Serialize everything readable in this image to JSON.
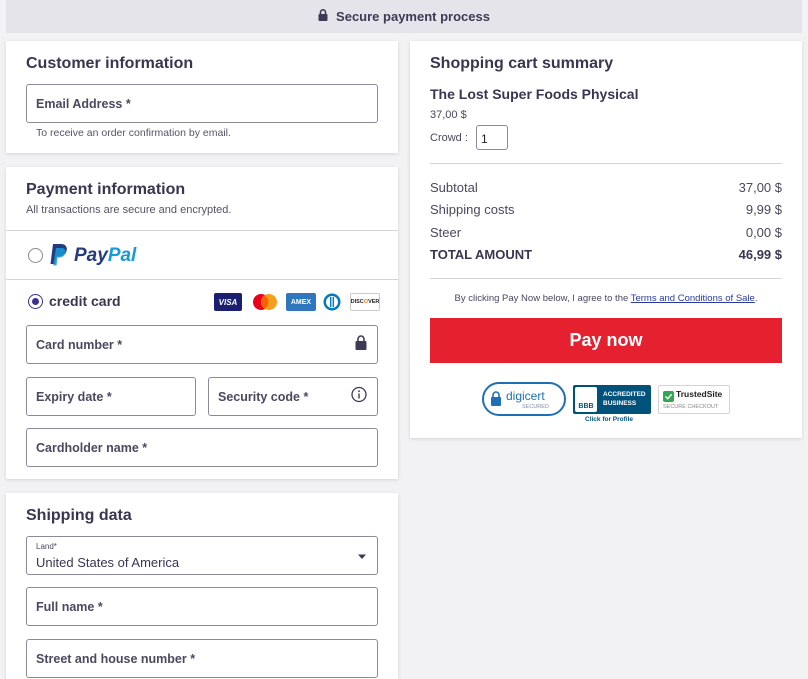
{
  "topbar": {
    "text": "Secure payment process",
    "icon": "lock-icon"
  },
  "customer": {
    "title": "Customer information",
    "email_label": "Email Address *",
    "email_hint": "To receive an order confirmation by email."
  },
  "payment": {
    "title": "Payment information",
    "subtitle": "All transactions are secure and encrypted.",
    "paypal_label": "PayPal",
    "paypal_label_a": "Pay",
    "paypal_label_b": "Pal",
    "credit_card_label": "credit card",
    "card_logos": [
      "VISA",
      "Mastercard",
      "AMEX",
      "Diners",
      "DISCOVER"
    ],
    "card_number_label": "Card number *",
    "expiry_label": "Expiry date *",
    "security_label": "Security code *",
    "cardholder_label": "Cardholder name *"
  },
  "shipping": {
    "title": "Shipping data",
    "land_label": "Land*",
    "land_value": "United States of America",
    "full_name_label": "Full name *",
    "street_label": "Street and house number *"
  },
  "summary": {
    "title": "Shopping cart summary",
    "product_name": "The Lost Super Foods Physical",
    "product_price": "37,00 $",
    "qty_label": "Crowd :",
    "qty_value": "1",
    "rows": [
      {
        "label": "Subtotal",
        "value": "37,00 $"
      },
      {
        "label": "Shipping costs",
        "value": "9,99 $"
      },
      {
        "label": "Steer",
        "value": "0,00 $"
      }
    ],
    "total_label": "TOTAL AMOUNT",
    "total_value": "46,99 $",
    "terms_prefix": "By clicking Pay Now below, I agree to the",
    "terms_link": "Terms and Conditions of Sale",
    "terms_suffix": ".",
    "pay_button": "Pay now",
    "badges": {
      "digicert": "digicert",
      "digicert_sub": "SECURED",
      "bbb_line1": "ACCREDITED",
      "bbb_line2": "BUSINESS",
      "bbb_mark": "BBB",
      "bbb_caption": "Click for Profile",
      "trustedsite": "TrustedSite",
      "trustedsite_sub": "SECURE CHECKOUT"
    }
  },
  "colors": {
    "accent": "#e5202f",
    "radio": "#3b2f8f",
    "link": "#2a3a9b",
    "paypal_dark": "#253b80",
    "paypal_light": "#179bd7"
  }
}
